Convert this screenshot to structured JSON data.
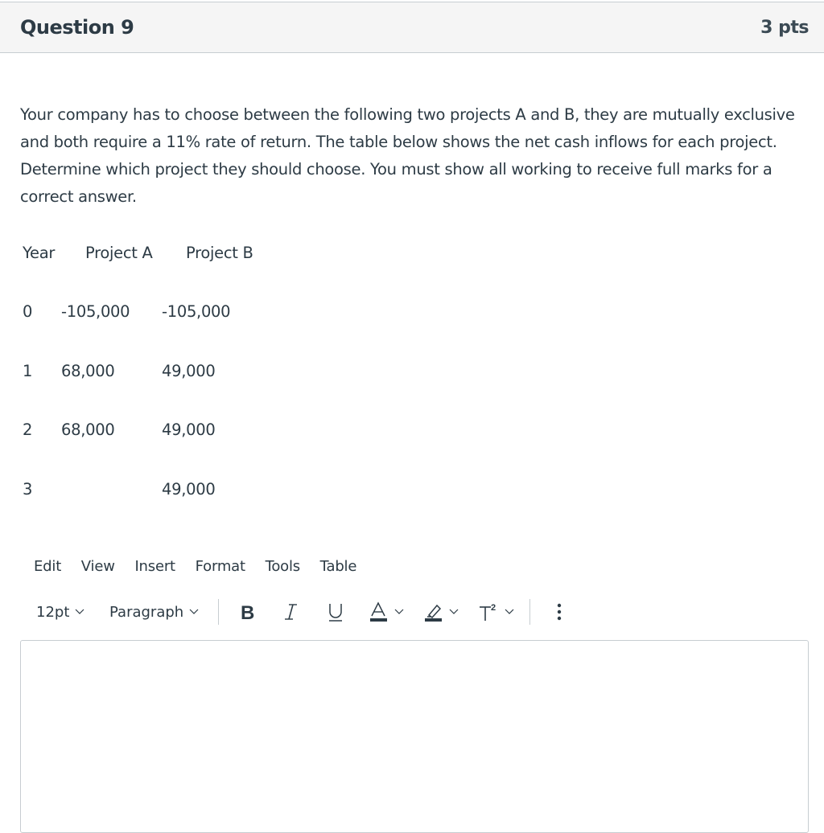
{
  "header": {
    "title": "Question 9",
    "points": "3 pts"
  },
  "question": {
    "text": "Your company has to choose between the following two projects A and B, they are mutually exclusive and both require a 11% rate of return.  The table below shows the net cash inflows for each project.   Determine which project they should choose.  You must show all working to receive full marks for a correct answer."
  },
  "table": {
    "headers": [
      "Year",
      "Project A",
      "Project B"
    ],
    "rows": [
      {
        "year": "0",
        "a": "-105,000",
        "b": "-105,000"
      },
      {
        "year": "1",
        "a": "68,000",
        "b": "49,000"
      },
      {
        "year": "2",
        "a": "68,000",
        "b": "49,000"
      },
      {
        "year": "3",
        "a": "",
        "b": "49,000"
      }
    ]
  },
  "editor": {
    "menu": [
      "Edit",
      "View",
      "Insert",
      "Format",
      "Tools",
      "Table"
    ],
    "font_size": "12pt",
    "block_format": "Paragraph",
    "bold_icon": "bold-icon",
    "italic_icon": "italic-icon",
    "underline_icon": "underline-icon",
    "text_color_icon": "text-color-icon",
    "highlight_icon": "highlight-icon",
    "superscript_icon": "superscript-icon",
    "more_icon": "more-vertical-icon",
    "content": ""
  }
}
